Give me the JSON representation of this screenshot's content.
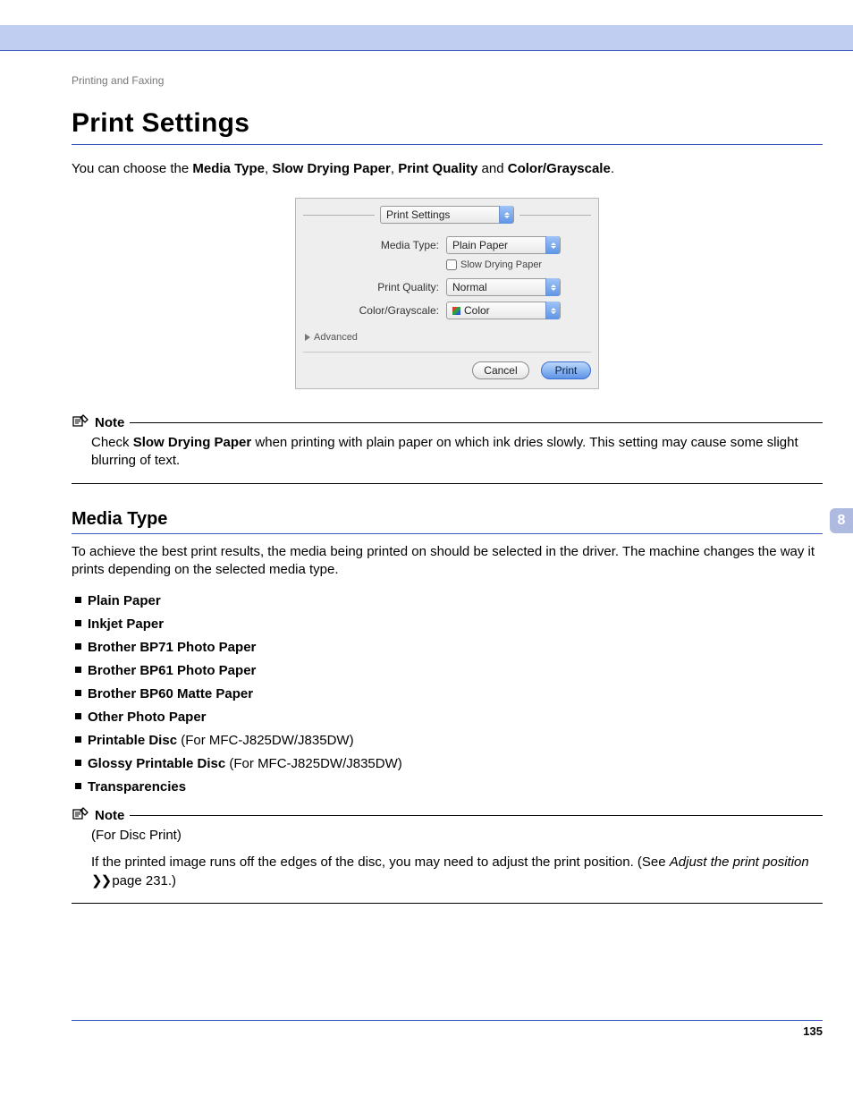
{
  "chapter_tab": "8",
  "running_head": "Printing and Faxing",
  "page_title": "Print Settings",
  "intro": {
    "pre": "You can choose the ",
    "b1": "Media Type",
    "sep1": ", ",
    "b2": "Slow Drying Paper",
    "sep2": ", ",
    "b3": "Print Quality",
    "sep3": " and ",
    "b4": "Color/Grayscale",
    "post": "."
  },
  "dialog": {
    "section_select": "Print Settings",
    "rows": {
      "media_type_label": "Media Type:",
      "media_type_value": "Plain Paper",
      "slow_drying_label": "Slow Drying Paper",
      "print_quality_label": "Print Quality:",
      "print_quality_value": "Normal",
      "color_label": "Color/Grayscale:",
      "color_value": "Color"
    },
    "advanced": "Advanced",
    "cancel": "Cancel",
    "print": "Print"
  },
  "note1": {
    "head": "Note",
    "pre": "Check ",
    "bold": "Slow Drying Paper",
    "post": " when printing with plain paper on which ink dries slowly. This setting may cause some slight blurring of text."
  },
  "section_media_type": "Media Type",
  "media_para": "To achieve the best print results, the media being printed on should be selected in the driver. The machine changes the way it prints depending on the selected media type.",
  "media_items": [
    {
      "bold": "Plain Paper",
      "rest": ""
    },
    {
      "bold": "Inkjet Paper",
      "rest": ""
    },
    {
      "bold": "Brother BP71 Photo Paper",
      "rest": ""
    },
    {
      "bold": "Brother BP61 Photo Paper",
      "rest": ""
    },
    {
      "bold": "Brother BP60 Matte Paper",
      "rest": ""
    },
    {
      "bold": "Other Photo Paper",
      "rest": ""
    },
    {
      "bold": "Printable Disc",
      "rest": " (For MFC-J825DW/J835DW)"
    },
    {
      "bold": "Glossy Printable Disc",
      "rest": " (For MFC-J825DW/J835DW)"
    },
    {
      "bold": "Transparencies",
      "rest": ""
    }
  ],
  "note2": {
    "head": "Note",
    "line1": "(For Disc Print)",
    "l2_pre": "If the printed image runs off the edges of the disc, you may need to adjust the print position. (See ",
    "l2_em": "Adjust the print position",
    "l2_arrows": " ❯❯ ",
    "l2_post": "page 231.)"
  },
  "page_number": "135"
}
